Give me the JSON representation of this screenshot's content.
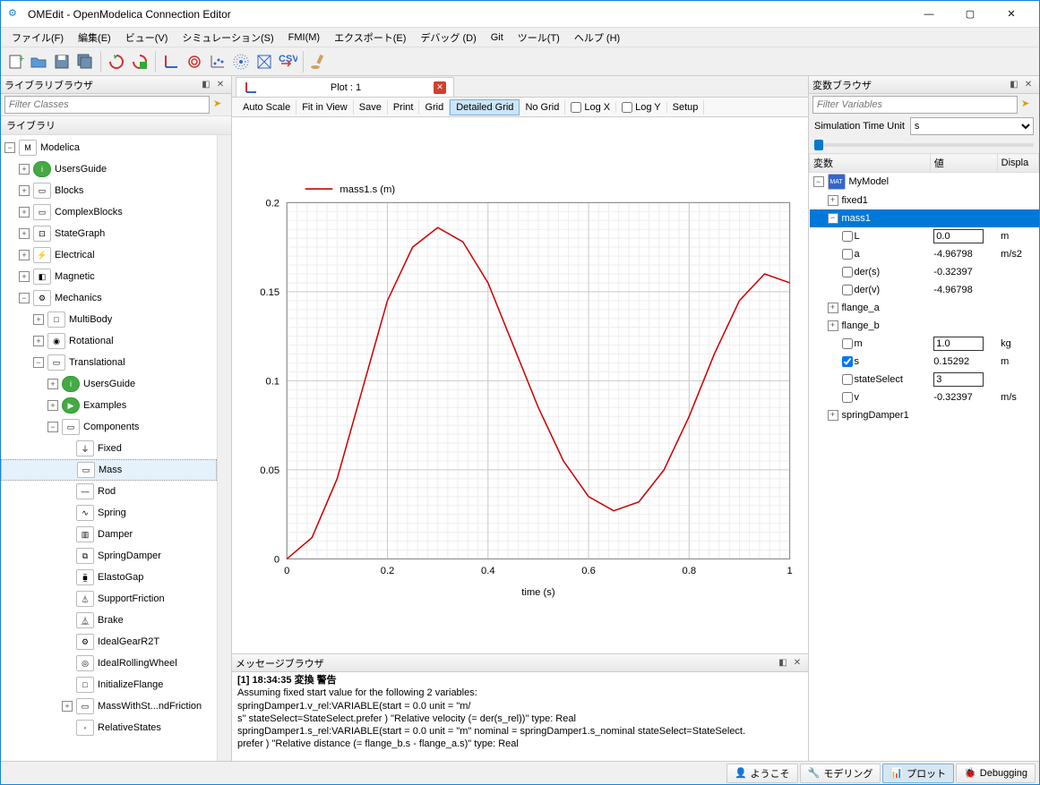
{
  "window": {
    "title": "OMEdit - OpenModelica Connection Editor"
  },
  "menu": [
    "ファイル(F)",
    "編集(E)",
    "ビュー(V)",
    "シミュレーション(S)",
    "FMI(M)",
    "エクスポート(E)",
    "デバッグ (D)",
    "Git",
    "ツール(T)",
    "ヘルプ (H)"
  ],
  "libBrowser": {
    "title": "ライブラリブラウザ",
    "filter_placeholder": "Filter Classes",
    "section": "ライブラリ",
    "tree": [
      {
        "d": 0,
        "exp": "-",
        "icon": "M",
        "label": "Modelica"
      },
      {
        "d": 1,
        "exp": "+",
        "icon": "i",
        "iconCls": "green",
        "label": "UsersGuide"
      },
      {
        "d": 1,
        "exp": "+",
        "icon": "▭",
        "label": "Blocks"
      },
      {
        "d": 1,
        "exp": "+",
        "icon": "▭",
        "label": "ComplexBlocks"
      },
      {
        "d": 1,
        "exp": "+",
        "icon": "⊡",
        "label": "StateGraph"
      },
      {
        "d": 1,
        "exp": "+",
        "icon": "⚡",
        "label": "Electrical"
      },
      {
        "d": 1,
        "exp": "+",
        "icon": "◧",
        "label": "Magnetic"
      },
      {
        "d": 1,
        "exp": "-",
        "icon": "⚙",
        "label": "Mechanics"
      },
      {
        "d": 2,
        "exp": "+",
        "icon": "□",
        "label": "MultiBody"
      },
      {
        "d": 2,
        "exp": "+",
        "icon": "◉",
        "label": "Rotational"
      },
      {
        "d": 2,
        "exp": "-",
        "icon": "▭",
        "label": "Translational"
      },
      {
        "d": 3,
        "exp": "+",
        "icon": "i",
        "iconCls": "green",
        "label": "UsersGuide"
      },
      {
        "d": 3,
        "exp": "+",
        "icon": "▶",
        "iconCls": "green",
        "label": "Examples"
      },
      {
        "d": 3,
        "exp": "-",
        "icon": "▭",
        "label": "Components"
      },
      {
        "d": 4,
        "exp": "",
        "icon": "⏚",
        "label": "Fixed"
      },
      {
        "d": 4,
        "exp": "",
        "icon": "▭",
        "label": "Mass",
        "sel": true
      },
      {
        "d": 4,
        "exp": "",
        "icon": "—",
        "label": "Rod"
      },
      {
        "d": 4,
        "exp": "",
        "icon": "∿",
        "label": "Spring"
      },
      {
        "d": 4,
        "exp": "",
        "icon": "▥",
        "label": "Damper"
      },
      {
        "d": 4,
        "exp": "",
        "icon": "⧉",
        "label": "SpringDamper"
      },
      {
        "d": 4,
        "exp": "",
        "icon": "⧯",
        "label": "ElastoGap"
      },
      {
        "d": 4,
        "exp": "",
        "icon": "⏃",
        "label": "SupportFriction"
      },
      {
        "d": 4,
        "exp": "",
        "icon": "⏅",
        "label": "Brake"
      },
      {
        "d": 4,
        "exp": "",
        "icon": "⚙",
        "label": "IdealGearR2T"
      },
      {
        "d": 4,
        "exp": "",
        "icon": "◎",
        "label": "IdealRollingWheel"
      },
      {
        "d": 4,
        "exp": "",
        "icon": "□",
        "label": "InitializeFlange"
      },
      {
        "d": 4,
        "exp": "+",
        "icon": "▭",
        "label": "MassWithSt...ndFriction"
      },
      {
        "d": 4,
        "exp": "",
        "icon": "◦",
        "label": "RelativeStates"
      }
    ]
  },
  "plotTab": {
    "title": "Plot : 1"
  },
  "plotToolbar": {
    "buttons": [
      "Auto Scale",
      "Fit in View",
      "Save",
      "Print",
      "Grid",
      "Detailed Grid",
      "No Grid"
    ],
    "active": "Detailed Grid",
    "checks": [
      "Log X",
      "Log Y"
    ],
    "rightButtons": [
      "Setup"
    ]
  },
  "chart_data": {
    "type": "line",
    "title": "",
    "xlabel": "time (s)",
    "ylabel": "",
    "xlim": [
      0,
      1
    ],
    "ylim": [
      0,
      0.2
    ],
    "xticks": [
      0,
      0.2,
      0.4,
      0.6,
      0.8,
      1
    ],
    "yticks": [
      0,
      0.05,
      0.1,
      0.15,
      0.2
    ],
    "legend": [
      "mass1.s (m)"
    ],
    "series": [
      {
        "name": "mass1.s (m)",
        "color": "#d00000",
        "x": [
          0.0,
          0.05,
          0.1,
          0.15,
          0.2,
          0.25,
          0.3,
          0.35,
          0.4,
          0.45,
          0.5,
          0.55,
          0.6,
          0.65,
          0.7,
          0.75,
          0.8,
          0.85,
          0.9,
          0.95,
          1.0
        ],
        "y": [
          0.0,
          0.012,
          0.045,
          0.095,
          0.145,
          0.175,
          0.186,
          0.178,
          0.155,
          0.12,
          0.085,
          0.055,
          0.035,
          0.027,
          0.032,
          0.05,
          0.08,
          0.115,
          0.145,
          0.16,
          0.155
        ]
      }
    ]
  },
  "messages": {
    "title": "メッセージブラウザ",
    "header": "[1] 18:34:35 変換 警告",
    "lines": [
      "Assuming fixed start value for the following 2 variables:",
      "         springDamper1.v_rel:VARIABLE(start = 0.0 unit = \"m/",
      "s\" stateSelect=StateSelect.prefer )  \"Relative velocity (= der(s_rel))\" type: Real",
      "         springDamper1.s_rel:VARIABLE(start = 0.0 unit = \"m\" nominal = springDamper1.s_nominal stateSelect=StateSelect.",
      "prefer )  \"Relative distance (= flange_b.s - flange_a.s)\" type: Real"
    ]
  },
  "varBrowser": {
    "title": "変数ブラウザ",
    "filter_placeholder": "Filter Variables",
    "unit_label": "Simulation Time Unit",
    "unit_value": "s",
    "cols": [
      "変数",
      "値",
      "Displa"
    ],
    "rows": [
      {
        "d": 0,
        "exp": "-",
        "icon": "mat",
        "label": "MyModel"
      },
      {
        "d": 1,
        "exp": "+",
        "label": "fixed1"
      },
      {
        "d": 1,
        "exp": "-",
        "label": "mass1",
        "sel": true
      },
      {
        "d": 2,
        "chk": false,
        "label": "L",
        "val": "0.0",
        "editable": true,
        "unit": "m"
      },
      {
        "d": 2,
        "chk": false,
        "label": "a",
        "val": "-4.96798",
        "unit": "m/s2"
      },
      {
        "d": 2,
        "chk": false,
        "label": "der(s)",
        "val": "-0.32397"
      },
      {
        "d": 2,
        "chk": false,
        "label": "der(v)",
        "val": "-4.96798"
      },
      {
        "d": 1,
        "exp": "+",
        "label": "flange_a"
      },
      {
        "d": 1,
        "exp": "+",
        "label": "flange_b"
      },
      {
        "d": 2,
        "chk": false,
        "label": "m",
        "val": "1.0",
        "editable": true,
        "unit": "kg"
      },
      {
        "d": 2,
        "chk": true,
        "label": "s",
        "val": "0.15292",
        "unit": "m"
      },
      {
        "d": 2,
        "chk": false,
        "label": "stateSelect",
        "val": "3",
        "editable": true
      },
      {
        "d": 2,
        "chk": false,
        "label": "v",
        "val": "-0.32397",
        "unit": "m/s"
      },
      {
        "d": 1,
        "exp": "+",
        "label": "springDamper1"
      }
    ]
  },
  "statusbar": {
    "buttons": [
      {
        "label": "ようこそ",
        "icon": "👤"
      },
      {
        "label": "モデリング",
        "icon": "🔧"
      },
      {
        "label": "プロット",
        "icon": "📊",
        "active": true
      },
      {
        "label": "Debugging",
        "icon": "🐞"
      }
    ]
  }
}
